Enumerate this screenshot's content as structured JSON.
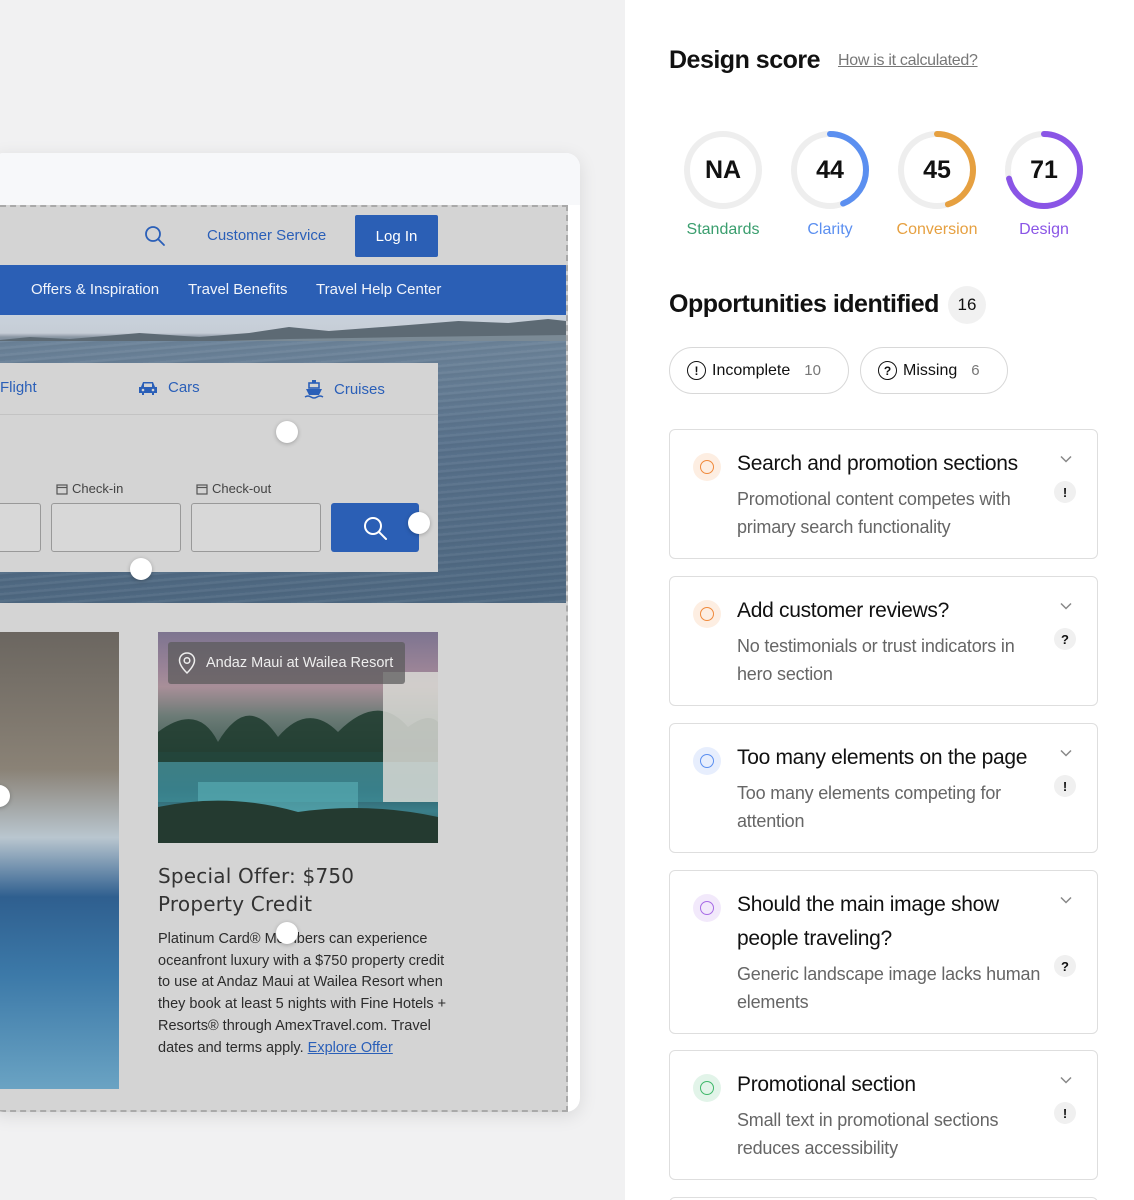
{
  "preview": {
    "header": {
      "customer_service": "Customer Service",
      "login": "Log In"
    },
    "nav": [
      "Offers & Inspiration",
      "Travel Benefits",
      "Travel Help Center"
    ],
    "booking": {
      "tabs": [
        {
          "label": "Flight",
          "icon": "plane-icon"
        },
        {
          "label": "Cars",
          "icon": "car-icon"
        },
        {
          "label": "Cruises",
          "icon": "ship-icon"
        }
      ],
      "check_in_label": "Check-in",
      "check_out_label": "Check-out"
    },
    "promo": {
      "location": "Andaz Maui at Wailea Resort",
      "title": "Special Offer: $750 Property Credit",
      "body": "Platinum Card® Members can experience oceanfront luxury with a $750 property credit to use at Andaz Maui at Wailea Resort when they book at least 5 nights with Fine Hotels + Resorts® through AmexTravel.com. Travel dates and terms apply.",
      "link": "Explore Offer"
    }
  },
  "panel": {
    "title": "Design score",
    "how_link": "How is it calculated?",
    "scores": [
      {
        "value": "NA",
        "label": "Standards",
        "fraction": 0,
        "color": "#3a9e6e"
      },
      {
        "value": "44",
        "label": "Clarity",
        "fraction": 0.44,
        "color": "#5b8ff0"
      },
      {
        "value": "45",
        "label": "Conversion",
        "fraction": 0.45,
        "color": "#e6a040"
      },
      {
        "value": "71",
        "label": "Design",
        "fraction": 0.71,
        "color": "#8a55e6"
      }
    ],
    "opportunities_title": "Opportunities identified",
    "opportunities_count": "16",
    "filters": [
      {
        "label": "Incomplete",
        "count": "10",
        "icon": "exclamation-circle-icon"
      },
      {
        "label": "Missing",
        "count": "6",
        "icon": "question-circle-icon"
      }
    ],
    "cards": [
      {
        "title": "Search and promotion sections",
        "desc": "Promotional content competes with primary search functionality",
        "flag": "!",
        "color": "#f08a3c"
      },
      {
        "title": "Add customer reviews?",
        "desc": "No testimonials or trust indicators in hero section",
        "flag": "?",
        "color": "#f08a3c"
      },
      {
        "title": "Too many elements on the page",
        "desc": "Too many elements competing for attention",
        "flag": "!",
        "color": "#5b8ff0"
      },
      {
        "title": "Should the main image show people traveling?",
        "desc": "Generic landscape image lacks human elements",
        "flag": "?",
        "color": "#a76be6"
      },
      {
        "title": "Promotional section",
        "desc": "Small text in promotional sections reduces accessibility",
        "flag": "!",
        "color": "#3fb86a"
      }
    ]
  }
}
